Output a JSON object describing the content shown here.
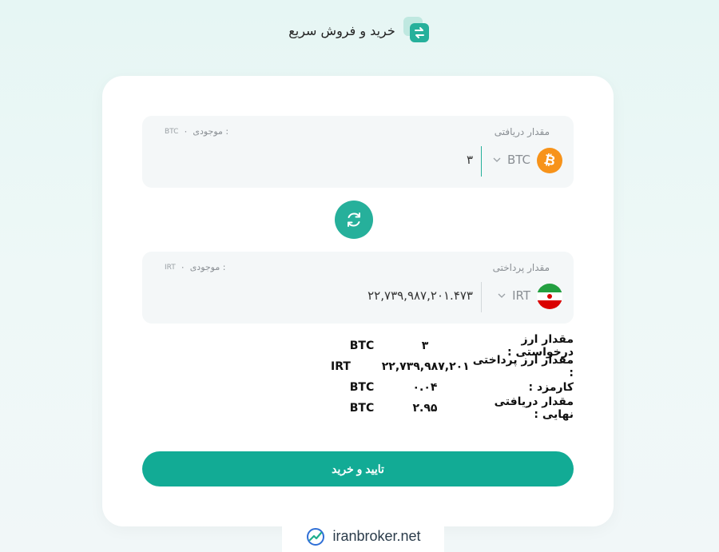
{
  "header": {
    "title": "خرید و فروش سریع",
    "icon": "swap-icon"
  },
  "receive": {
    "label": "مقدار دریافتی",
    "balance_label": "موجودی :",
    "balance_value": "۰",
    "balance_currency": "BTC",
    "currency": "BTC",
    "amount": "۳",
    "coin_icon": "bitcoin-icon"
  },
  "swap": {
    "icon": "refresh-icon"
  },
  "pay": {
    "label": "مقدار پرداختی",
    "balance_label": "موجودی :",
    "balance_value": "۰",
    "balance_currency": "IRT",
    "currency": "IRT",
    "amount": "۲۲,۷۳۹,۹۸۷,۲۰۱.۴۷۳",
    "coin_icon": "iran-flag-icon"
  },
  "summary": [
    {
      "label": "مقدار ارز درخواستی :",
      "value": "۳",
      "unit": "BTC"
    },
    {
      "label": "مقدار ارز پرداختی :",
      "value": "۲۲,۷۳۹,۹۸۷,۲۰۱",
      "unit": "IRT"
    },
    {
      "label": "کارمزد :",
      "value": "۰.۰۴",
      "unit": "BTC"
    },
    {
      "label": "مقدار دریافتی نهایی :",
      "value": "۲.۹۵",
      "unit": "BTC"
    }
  ],
  "confirm_label": "تایید و خرید",
  "footer": {
    "brand": "iranbroker.net",
    "logo": "chart-logo-icon"
  },
  "colors": {
    "accent": "#12ab95",
    "bitcoin": "#f7931a"
  }
}
